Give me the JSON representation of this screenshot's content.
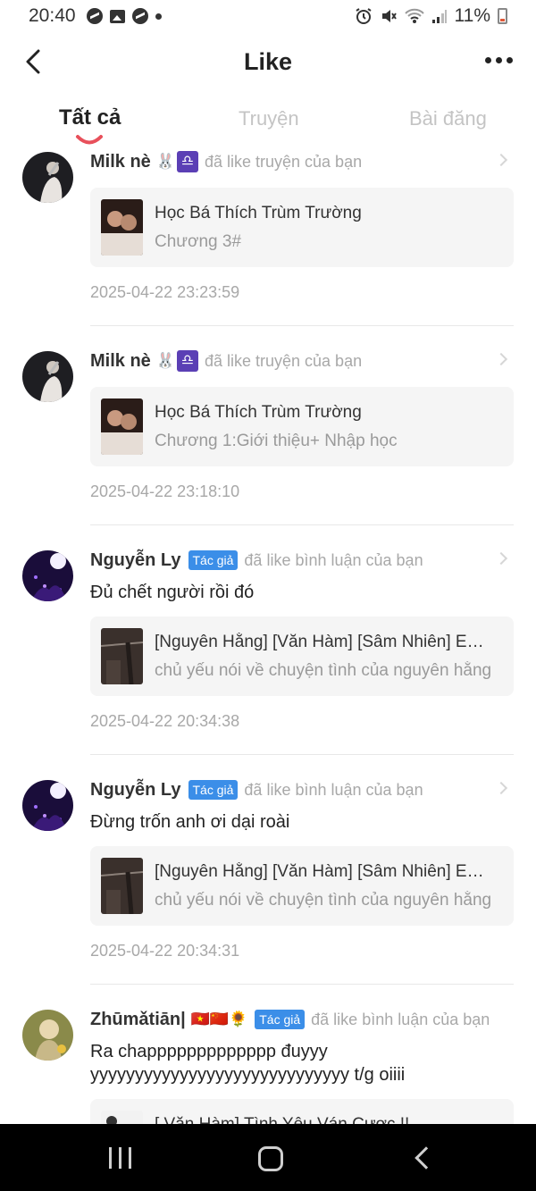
{
  "status_bar": {
    "time": "20:40",
    "battery": "11%",
    "icons": [
      "messenger-icon",
      "gallery-icon",
      "messenger-icon",
      "dot-icon",
      "alarm-icon",
      "mute-icon",
      "wifi-icon",
      "signal-icon",
      "battery-icon"
    ]
  },
  "header": {
    "title": "Like",
    "back_icon": "chevron-left-icon",
    "more_icon": "more-horizontal-icon"
  },
  "tabs": [
    {
      "label": "Tất cả",
      "active": true
    },
    {
      "label": "Truyện",
      "active": false
    },
    {
      "label": "Bài đăng",
      "active": false
    }
  ],
  "colors": {
    "accent": "#e8505b",
    "badge": "#3b8ee8",
    "muted_text": "#a8a8a8",
    "card_bg": "#f5f5f5"
  },
  "feed": [
    {
      "user": "Milk nè",
      "emoji": "🐰",
      "sign": "♎",
      "badge": "",
      "action": "đã like truyện của bạn",
      "comment": "",
      "card_title": "Học Bá Thích Trùm Trường",
      "card_sub": "Chương 3#",
      "time": "2025-04-22 23:23:59"
    },
    {
      "user": "Milk nè",
      "emoji": "🐰",
      "sign": "♎",
      "badge": "",
      "action": "đã like truyện của bạn",
      "comment": "",
      "card_title": "Học Bá Thích Trùm Trường",
      "card_sub": "Chương 1:Giới thiệu+ Nhập học",
      "time": "2025-04-22 23:18:10"
    },
    {
      "user": "Nguyễn Ly",
      "badge": "Tác giả",
      "action": "đã like bình luận của bạn",
      "comment": "Đủ chết người rồi đó",
      "card_title": "[Nguyên Hằng] [Văn Hàm] [Sâm Nhiên] Em ...",
      "card_sub": "chủ yếu nói về chuyện tình của nguyên hằng",
      "time": "2025-04-22 20:34:38"
    },
    {
      "user": "Nguyễn Ly",
      "badge": "Tác giả",
      "action": "đã like bình luận của bạn",
      "comment": "Đừng trốn anh ơi dại roài",
      "card_title": "[Nguyên Hằng] [Văn Hàm] [Sâm Nhiên] Em ...",
      "card_sub": "chủ yếu nói về chuyện tình của nguyên hằng",
      "time": "2025-04-22 20:34:31"
    },
    {
      "user": "Zhūmǎtiān|",
      "emoji": "🇻🇳🇨🇳🌻",
      "badge": "Tác giả",
      "action": "đã like bình luận của bạn",
      "comment": "Ra chappppppppppppp đuyyy yyyyyyyyyyyyyyyyyyyyyyyyyyyyy t/g oiiii",
      "card_title": "[ Văn Hàm] Tình Yêu Ván Cược !!",
      "card_sub": "",
      "time": ""
    }
  ]
}
